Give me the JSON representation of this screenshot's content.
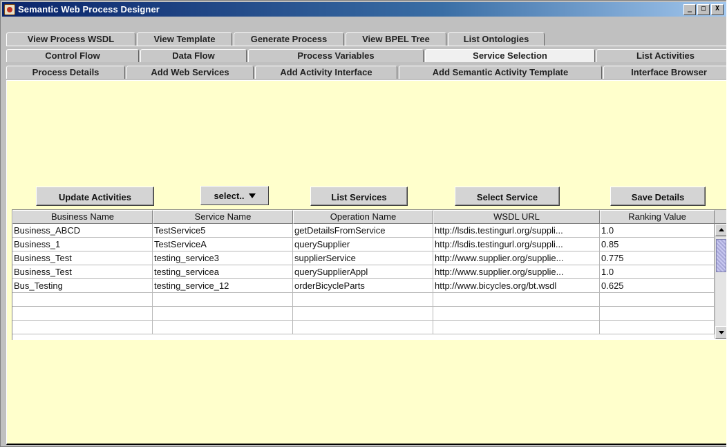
{
  "window": {
    "title": "Semantic Web Process Designer",
    "controls": [
      "_",
      "□",
      "X"
    ]
  },
  "tabs": {
    "row1": [
      "View Process WSDL",
      "View Template",
      "Generate Process",
      "View BPEL Tree",
      "List Ontologies"
    ],
    "row2": [
      "Control Flow",
      "Data Flow",
      "Process Variables",
      "Service Selection",
      "List Activities"
    ],
    "row3": [
      "Process Details",
      "Add Web Services",
      "Add Activity Interface",
      "Add Semantic Activity Template",
      "Interface Browser"
    ],
    "selected": "Service Selection"
  },
  "toolbar": {
    "update_activities": "Update Activities",
    "select_combo": "select..",
    "list_services": "List Services",
    "select_service": "Select Service",
    "save_details": "Save Details"
  },
  "table": {
    "columns": [
      "Business Name",
      "Service Name",
      "Operation Name",
      "WSDL URL",
      "Ranking Value"
    ],
    "rows": [
      [
        "Business_ABCD",
        "TestService5",
        "getDetailsFromService",
        "http://lsdis.testingurl.org/suppli...",
        "1.0"
      ],
      [
        "Business_1",
        "TestServiceA",
        "querySupplier",
        "http://lsdis.testingurl.org/suppli...",
        "0.85"
      ],
      [
        "Business_Test",
        "testing_service3",
        "supplierService",
        "http://www.supplier.org/supplie...",
        "0.775"
      ],
      [
        "Business_Test",
        "testing_servicea",
        "querySupplierAppl",
        "http://www.supplier.org/supplie...",
        "1.0"
      ],
      [
        "Bus_Testing",
        "testing_service_12",
        "orderBicycleParts",
        "http://www.bicycles.org/bt.wsdl",
        "0.625"
      ],
      [
        "",
        "",
        "",
        "",
        ""
      ],
      [
        "",
        "",
        "",
        "",
        ""
      ],
      [
        "",
        "",
        "",
        "",
        ""
      ]
    ]
  },
  "colors": {
    "panel_bg": "#ffffcc",
    "titlebar": "#0a246a",
    "selected_tab": "#f0f0f0"
  }
}
